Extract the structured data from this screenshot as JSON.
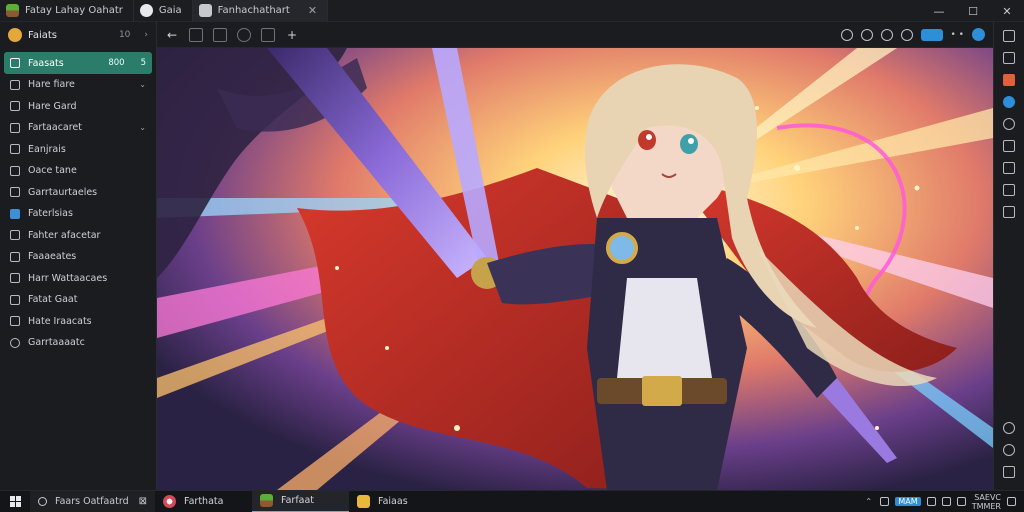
{
  "tabs": [
    {
      "label": "Fatay Lahay Oahatr",
      "icon": "minecraft-grass-icon",
      "active": false
    },
    {
      "label": "Gaia",
      "icon": "steam-icon",
      "active": false
    },
    {
      "label": "Fanhachathart",
      "icon": "photo-viewer-icon",
      "active": true
    }
  ],
  "window": {
    "min": "—",
    "max": "☐",
    "close": "✕"
  },
  "sidebar": {
    "title": "Faiats",
    "count": "10",
    "items": [
      {
        "label": "Faasats",
        "badge": "800",
        "badge2": "5",
        "selected": true,
        "chevron": ""
      },
      {
        "label": "Hare fiare",
        "chevron": "⌄"
      },
      {
        "label": "Hare Gard",
        "chevron": ""
      },
      {
        "label": "Fartaacaret",
        "chevron": "⌄"
      },
      {
        "label": "Eanjrais",
        "chevron": ""
      },
      {
        "label": "Oace tane",
        "chevron": ""
      },
      {
        "label": "Garrtaurtaeles",
        "chevron": ""
      },
      {
        "label": "Faterlsias",
        "chevron": ""
      },
      {
        "label": "Fahter afacetar",
        "chevron": ""
      },
      {
        "label": "Faaaeates",
        "chevron": ""
      },
      {
        "label": "Harr Wattaacaes",
        "chevron": ""
      },
      {
        "label": "Fatat Gaat",
        "chevron": ""
      },
      {
        "label": "Hate Iraacats",
        "chevron": ""
      },
      {
        "label": "Garrtaaaatc",
        "chevron": ""
      }
    ]
  },
  "toolbar": {
    "back": "←",
    "add": "+"
  },
  "taskbar": {
    "search_placeholder": "Faars Oatfaatrd",
    "items": [
      {
        "label": "Farthata",
        "icon": "chrome-icon",
        "active": false
      },
      {
        "label": "Farfaat",
        "icon": "minecraft-icon",
        "active": true
      },
      {
        "label": "Faiaas",
        "icon": "folder-icon",
        "active": false
      }
    ],
    "tray_label": "MAM",
    "clock_time": "SAEVC",
    "clock_date": "TMMER"
  },
  "colors": {
    "accent": "#2b7d6a",
    "blue": "#2d8fd8",
    "orange": "#e0603a"
  }
}
